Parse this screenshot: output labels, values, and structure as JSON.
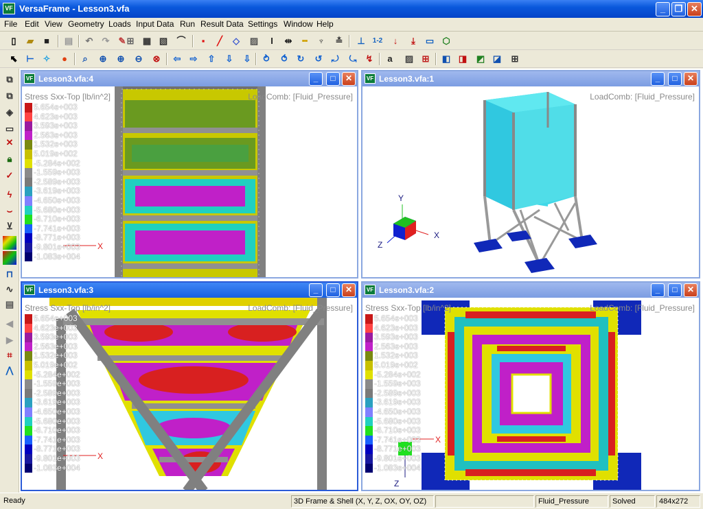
{
  "app": {
    "title": "VersaFrame - Lesson3.vfa",
    "icon_label": "VF",
    "window_buttons": [
      "_",
      "❐",
      "✕"
    ]
  },
  "menu": [
    "File",
    "Edit",
    "View",
    "Geometry",
    "Loads",
    "Input Data",
    "Run",
    "Result Data",
    "Settings",
    "Window",
    "Help"
  ],
  "toolbar1": [
    "new-icon",
    "open-icon",
    "save-icon",
    "print-icon",
    "undo-icon",
    "redo-icon",
    "redraw-icon",
    "joint-icon",
    "frame-icon",
    "shell-icon",
    "curve-icon",
    "text-icon",
    "dimension-icon",
    "line-style-icon",
    "hatch-icon",
    "support-icon",
    "numbering-icon",
    "load-icon",
    "distributed-load-icon",
    "grid-icon",
    "3d-view-icon"
  ],
  "toolbar2": [
    "select-icon",
    "select-member-icon",
    "select-joint-icon",
    "point-icon",
    "zoom-window-icon",
    "zoom-extents-icon",
    "zoom-in-icon",
    "zoom-out-icon",
    "zoom-previous-icon",
    "pan-left-icon",
    "pan-right-icon",
    "pan-up-icon",
    "pan-down-icon",
    "rotate-x-icon",
    "rotate-y-icon",
    "rotate-z-icon",
    "rotate-xn-icon",
    "rotate-yn-icon",
    "rotate-zn-icon",
    "text-size-icon",
    "fill-icon",
    "section-icon",
    "view-front-icon",
    "view-side-icon",
    "view-top-icon",
    "view-iso-icon",
    "table-icon"
  ],
  "left_toolbar": [
    "copy-icon",
    "move-icon",
    "rotate-icon",
    "select-box-icon",
    "delete-icon",
    "lock-icon",
    "check-icon",
    "lightning-icon",
    "release-icon",
    "offset-icon",
    "contour-icon",
    "color-icon",
    "frame-view-icon",
    "spring-icon",
    "report-icon",
    "back-icon",
    "forward-icon",
    "crop-icon",
    "graph-icon"
  ],
  "legend": {
    "label": "Stress Sxx-Top [lb/in^2]",
    "values": [
      "5.654e+003",
      "4.623e+003",
      "3.593e+003",
      "2.563e+003",
      "1.532e+003",
      "5.019e+002",
      "-5.284e+002",
      "-1.559e+003",
      "-2.589e+003",
      "-3.619e+003",
      "-4.650e+003",
      "-5.680e+003",
      "-6.710e+003",
      "-7.741e+003",
      "-8.771e+003",
      "-9.801e+003",
      "-1.083e+004"
    ],
    "colors": [
      "#c81818",
      "#ff4444",
      "#9a1aa0",
      "#c020c8",
      "#7a8a10",
      "#c8c000",
      "#e0e000",
      "#8a8a8a",
      "#7a7a7a",
      "#2aa0c0",
      "#8080ff",
      "#20d0c0",
      "#20e020",
      "#1860ff",
      "#0000c0",
      "#1818a0",
      "#000070"
    ]
  },
  "load_combo": "LoadComb: [Fluid_Pressure]",
  "windows": {
    "w4": {
      "title": "Lesson3.vfa:4"
    },
    "w1": {
      "title": "Lesson3.vfa:1"
    },
    "w3": {
      "title": "Lesson3.vfa:3"
    },
    "w2": {
      "title": "Lesson3.vfa:2"
    }
  },
  "axes": {
    "x": "X",
    "y": "Y",
    "z": "Z"
  },
  "status": {
    "ready": "Ready",
    "mode": "3D Frame & Shell (X, Y, Z, OX, OY, OZ)",
    "empty": "",
    "loadcase": "Fluid_Pressure",
    "state": "Solved",
    "size": "484x272"
  }
}
